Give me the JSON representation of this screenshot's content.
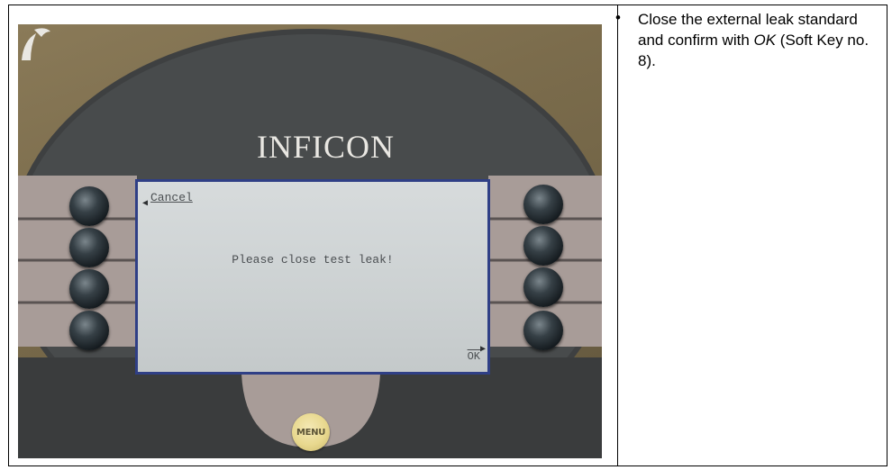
{
  "photo": {
    "brand": "INFICON",
    "lcd": {
      "cancel_label": "Cancel",
      "message": "Please close test leak!",
      "ok_label": "OK"
    },
    "menu_label": "MENU",
    "colors": {
      "panel": "#3f4142",
      "lcd_border": "#2f3f86",
      "lcd_screen": "#d2d6d7",
      "menu_button": "#e8d88e"
    }
  },
  "instruction": {
    "bullet": "•",
    "text_before": "Close the external leak standard and confirm with ",
    "ok_italic": "OK",
    "text_after": " (Soft Key no. 8)."
  }
}
